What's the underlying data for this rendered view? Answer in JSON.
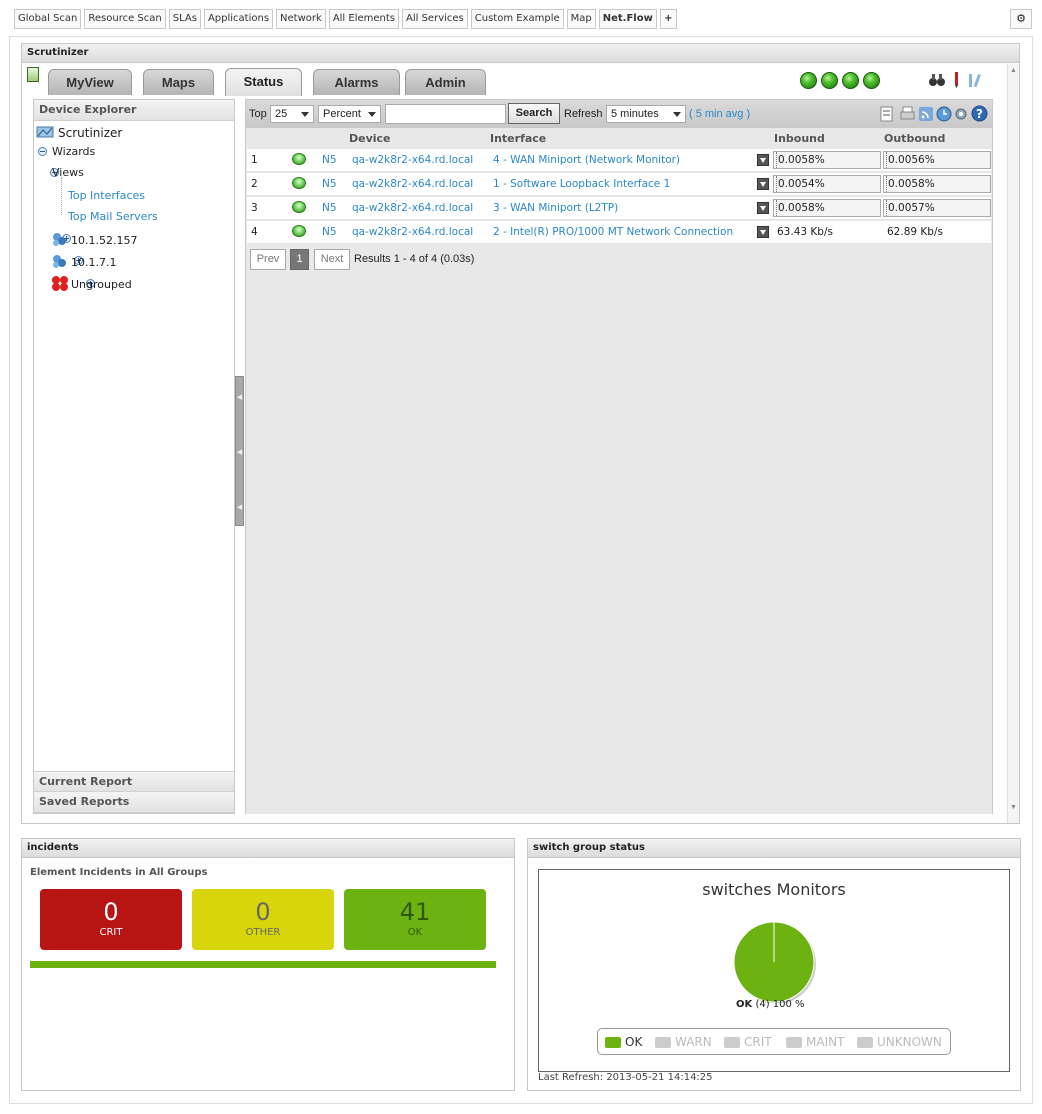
{
  "top_tabs": [
    "Global Scan",
    "Resource Scan",
    "SLAs",
    "Applications",
    "Network",
    "All Elements",
    "All Services",
    "Custom Example",
    "Map",
    "Net.Flow",
    "+"
  ],
  "main_panel": {
    "title": "Scrutinizer"
  },
  "nav_tabs": [
    "MyView",
    "Maps",
    "Status",
    "Alarms",
    "Admin"
  ],
  "explorer": {
    "title": "Device Explorer",
    "root": "Scrutinizer",
    "items": [
      {
        "label": "Wizards"
      },
      {
        "label": "Views",
        "children": [
          "Top Interfaces",
          "Top Mail Servers"
        ]
      },
      {
        "label": "10.1.52.157"
      },
      {
        "label": "10.1.7.1"
      },
      {
        "label": "Ungrouped"
      }
    ],
    "current_report": "Current Report",
    "saved_reports": "Saved Reports"
  },
  "toolbar": {
    "top_label": "Top",
    "top_value": "25",
    "unit_value": "Percent",
    "search_value": "",
    "search_button": "Search",
    "refresh_label": "Refresh",
    "refresh_value": "5 minutes",
    "avg_link": "( 5 min avg )"
  },
  "table": {
    "headers": {
      "device": "Device",
      "interface": "Interface",
      "inbound": "Inbound",
      "outbound": "Outbound"
    },
    "rows": [
      {
        "n": "1",
        "ns": "N5",
        "device": "qa-w2k8r2-x64.rd.local",
        "iface": "4 - WAN Miniport (Network Monitor)",
        "in": "0.0058%",
        "out": "0.0056%"
      },
      {
        "n": "2",
        "ns": "N5",
        "device": "qa-w2k8r2-x64.rd.local",
        "iface": "1 - Software Loopback Interface 1",
        "in": "0.0054%",
        "out": "0.0058%"
      },
      {
        "n": "3",
        "ns": "N5",
        "device": "qa-w2k8r2-x64.rd.local",
        "iface": "3 - WAN Miniport (L2TP)",
        "in": "0.0058%",
        "out": "0.0057%"
      },
      {
        "n": "4",
        "ns": "N5",
        "device": "qa-w2k8r2-x64.rd.local",
        "iface": "2 - Intel(R) PRO/1000 MT Network Connection",
        "in": "63.43 Kb/s",
        "out": "62.89 Kb/s"
      }
    ]
  },
  "pager": {
    "prev": "Prev",
    "page": "1",
    "next": "Next",
    "results": "Results 1 - 4 of 4 (0.03s)"
  },
  "incidents": {
    "title": "incidents",
    "subtitle": "Element Incidents in All Groups",
    "crit": {
      "value": "0",
      "label": "CRIT"
    },
    "other": {
      "value": "0",
      "label": "OTHER"
    },
    "ok": {
      "value": "41",
      "label": "OK"
    }
  },
  "switch_status": {
    "title": "switch group status",
    "chart_title": "switches Monitors",
    "pie_label_ok": "OK",
    "pie_label_rest": "(4) 100 %",
    "legend": [
      "OK",
      "WARN",
      "CRIT",
      "MAINT",
      "UNKNOWN"
    ],
    "last_refresh": "Last Refresh: 2013-05-21 14:14:25"
  },
  "chart_data": {
    "type": "pie",
    "title": "switches Monitors",
    "categories": [
      "OK",
      "WARN",
      "CRIT",
      "MAINT",
      "UNKNOWN"
    ],
    "values": [
      4,
      0,
      0,
      0,
      0
    ]
  },
  "colors": {
    "ok": "#6cb312",
    "crit": "#b81414",
    "other": "#d8d60a",
    "link": "#2a88c8"
  }
}
